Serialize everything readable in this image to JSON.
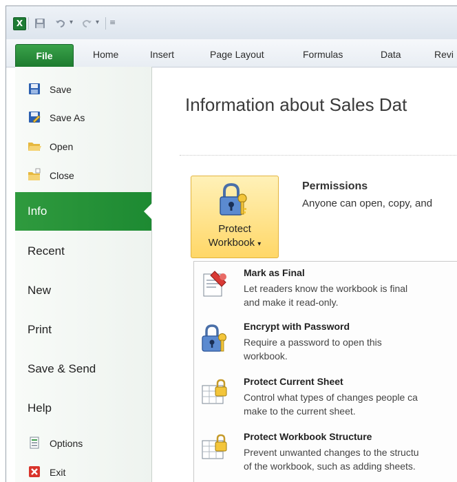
{
  "window": {
    "quick_access": [
      "save-icon",
      "undo-icon",
      "redo-icon",
      "customize-icon"
    ]
  },
  "ribbon": {
    "file_tab": "File",
    "tabs": [
      "Home",
      "Insert",
      "Page Layout",
      "Formulas",
      "Data",
      "Revi"
    ]
  },
  "backstage": {
    "commands_top": [
      {
        "label": "Save",
        "icon": "save-icon"
      },
      {
        "label": "Save As",
        "icon": "save-as-icon"
      },
      {
        "label": "Open",
        "icon": "open-folder-icon"
      },
      {
        "label": "Close",
        "icon": "close-folder-icon"
      }
    ],
    "nav": [
      "Info",
      "Recent",
      "New",
      "Print",
      "Save & Send",
      "Help"
    ],
    "active_nav": "Info",
    "commands_bottom": [
      {
        "label": "Options",
        "icon": "options-icon"
      },
      {
        "label": "Exit",
        "icon": "exit-icon"
      }
    ]
  },
  "main": {
    "title": "Information about Sales Dat",
    "protect_button": {
      "line1": "Protect",
      "line2": "Workbook",
      "icon": "protect-workbook-icon"
    },
    "permissions": {
      "title": "Permissions",
      "description": "Anyone can open, copy, and"
    },
    "dropdown": [
      {
        "title": "Mark as Final",
        "icon": "mark-final-icon",
        "desc": [
          "Let readers know the workbook is final",
          "and make it read-only."
        ]
      },
      {
        "title": "Encrypt with Password",
        "icon": "encrypt-icon",
        "desc": [
          "Require a password to open this",
          "workbook."
        ]
      },
      {
        "title": "Protect Current Sheet",
        "icon": "protect-sheet-icon",
        "desc": [
          "Control what types of changes people ca",
          "make to the current sheet."
        ]
      },
      {
        "title": "Protect Workbook Structure",
        "icon": "protect-structure-icon",
        "desc": [
          "Prevent unwanted changes to the structu",
          "of the workbook, such as adding sheets."
        ]
      }
    ]
  },
  "colors": {
    "file_green": "#1c7a2e",
    "active_nav_green": "#2f9a3e",
    "button_highlight": "#ffd767"
  }
}
